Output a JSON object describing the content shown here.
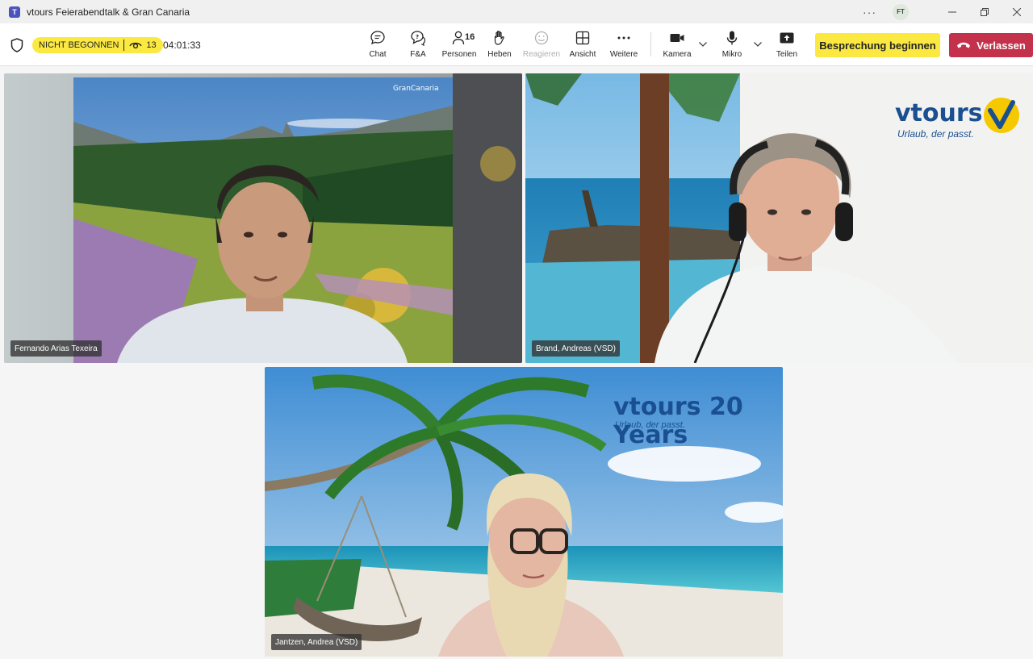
{
  "window": {
    "title": "vtours Feierabendtalk & Gran Canaria",
    "account_initials": "FT"
  },
  "meeting": {
    "status_label": "NICHT BEGONNEN",
    "viewers_count": "13",
    "elapsed_time": "04:01:33"
  },
  "toolbar": {
    "chat": "Chat",
    "qa": "F&A",
    "people": "Personen",
    "people_count": "16",
    "raise": "Heben",
    "react": "Reagieren",
    "view": "Ansicht",
    "more": "Weitere",
    "camera": "Kamera",
    "mic": "Mikro",
    "share": "Teilen",
    "start_button": "Besprechung beginnen",
    "leave_button": "Verlassen"
  },
  "participants": [
    {
      "name": "Fernando Arias Texeira",
      "background_logo": "GranCanaria"
    },
    {
      "name": "Brand, Andreas (VSD)",
      "background_logo": "vtours",
      "background_slogan": "Urlaub, der passt."
    },
    {
      "name": "Jantzen, Andrea (VSD)",
      "background_logo": "vtours 20 Years",
      "background_slogan": "Urlaub, der passt."
    }
  ],
  "colors": {
    "accent_yellow": "#fbe840",
    "leave_red": "#c4314b",
    "brand_blue": "#1a4f91",
    "brand_yellow": "#f5c800"
  }
}
